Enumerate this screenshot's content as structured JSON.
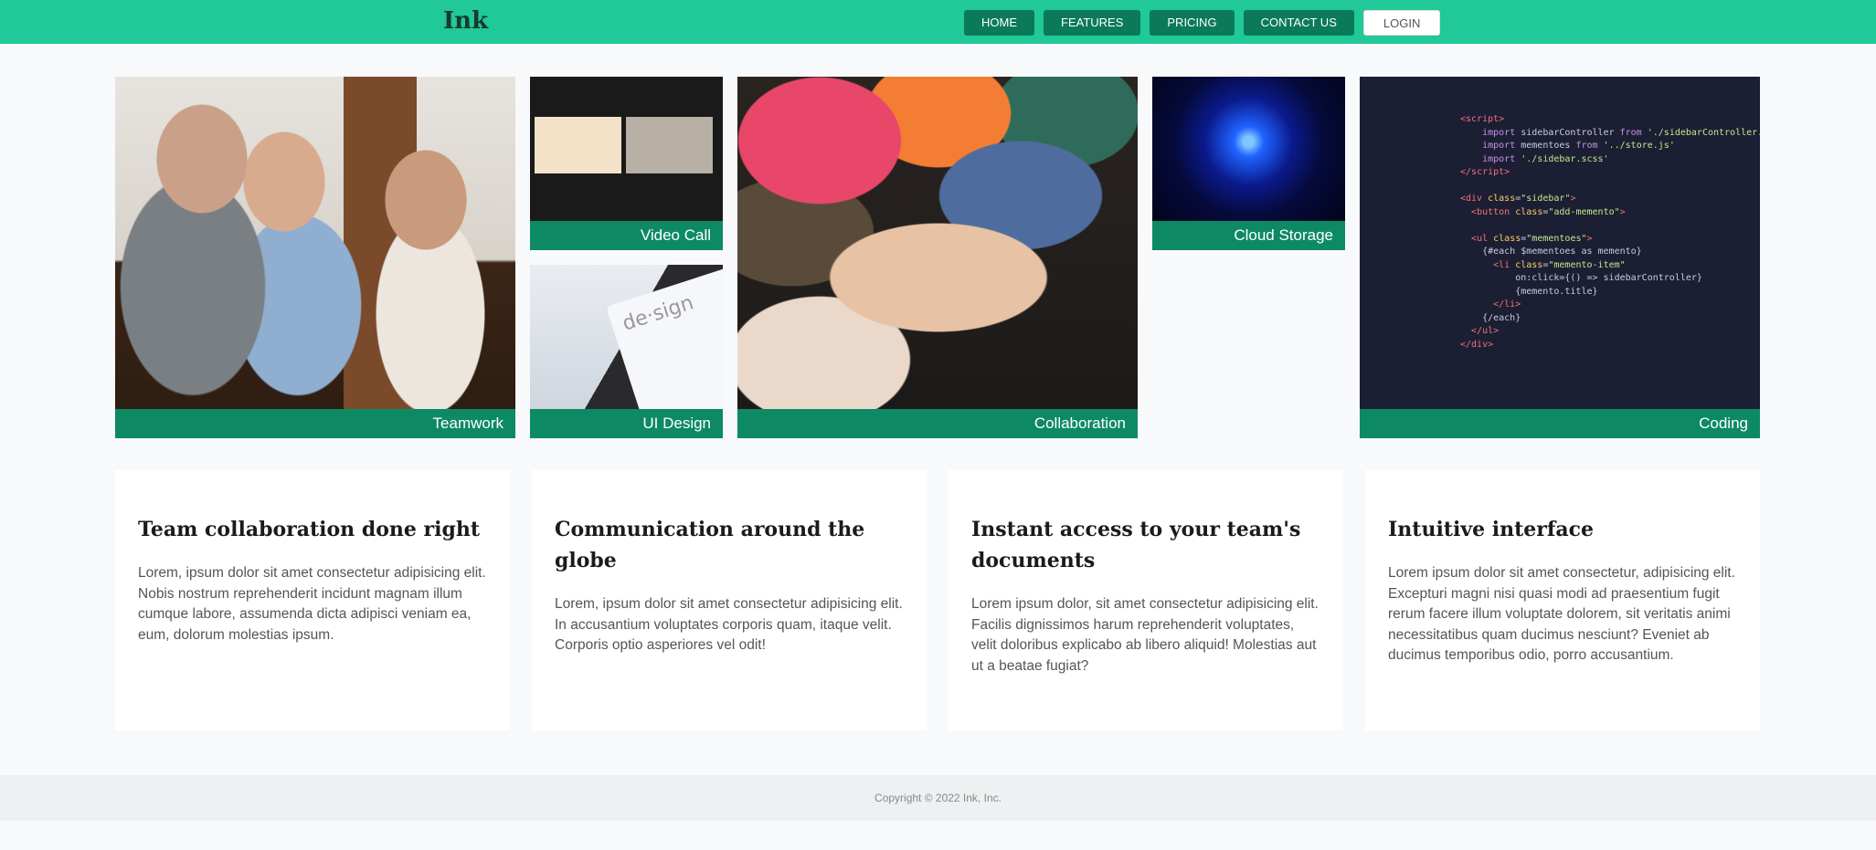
{
  "navbar": {
    "brand": "Ink",
    "links": [
      "HOME",
      "FEATURES",
      "PRICING",
      "CONTACT US"
    ],
    "login": "LOGIN"
  },
  "gallery": [
    {
      "caption": "Teamwork"
    },
    {
      "caption": "Video Call"
    },
    {
      "caption": "UI Design"
    },
    {
      "caption": "Collaboration"
    },
    {
      "caption": "Cloud Storage"
    },
    {
      "caption": "Coding"
    }
  ],
  "features": [
    {
      "title": "Team collaboration done right",
      "text": "Lorem, ipsum dolor sit amet consectetur adipisicing elit. Nobis nostrum reprehenderit incidunt magnam illum cumque labore, assumenda dicta adipisci veniam ea, eum, dolorum molestias ipsum."
    },
    {
      "title": "Communication around the globe",
      "text": "Lorem, ipsum dolor sit amet consectetur adipisicing elit. In accusantium voluptates corporis quam, itaque velit. Corporis optio asperiores vel odit!"
    },
    {
      "title": "Instant access to your team's documents",
      "text": "Lorem ipsum dolor, sit amet consectetur adipisicing elit. Facilis dignissimos harum reprehenderit voluptates, velit doloribus explicabo ab libero aliquid! Molestias aut ut a beatae fugiat?"
    },
    {
      "title": "Intuitive interface",
      "text": "Lorem ipsum dolor sit amet consectetur, adipisicing elit. Excepturi magni nisi quasi modi ad praesentium fugit rerum facere illum voluptate dolorem, sit veritatis animi necessitatibus quam ducimus nesciunt? Eveniet ab ducimus temporibus odio, porro accusantium."
    }
  ],
  "footer": {
    "copyright": "Copyright © 2022 Ink, Inc."
  },
  "colors": {
    "nav": "#20c997",
    "nav_button": "#0a7a58",
    "caption": "#0d8a64"
  }
}
